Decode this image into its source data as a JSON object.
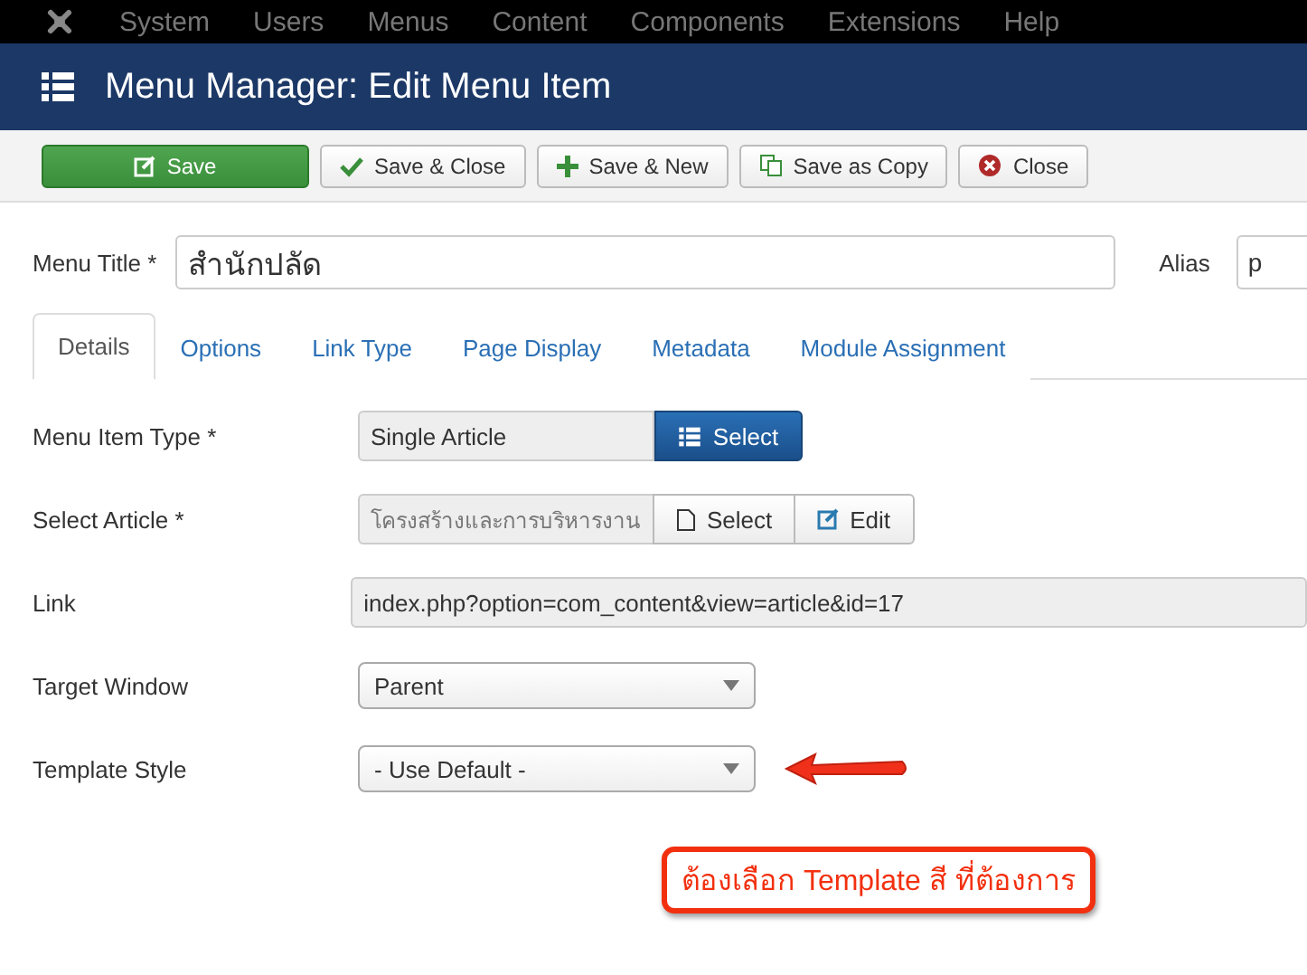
{
  "menubar": {
    "items": [
      "System",
      "Users",
      "Menus",
      "Content",
      "Components",
      "Extensions",
      "Help"
    ]
  },
  "header": {
    "title": "Menu Manager: Edit Menu Item"
  },
  "toolbar": [
    {
      "label": "Save",
      "kind": "primary"
    },
    {
      "label": "Save & Close",
      "kind": "check"
    },
    {
      "label": "Save & New",
      "kind": "plus"
    },
    {
      "label": "Save as Copy",
      "kind": "copy"
    },
    {
      "label": "Close",
      "kind": "close"
    }
  ],
  "title_row": {
    "label": "Menu Title *",
    "value": "สำนักปลัด",
    "alias_label": "Alias",
    "alias_value": "p"
  },
  "tabs": [
    {
      "label": "Details",
      "selected": true
    },
    {
      "label": "Options",
      "selected": false
    },
    {
      "label": "Link Type",
      "selected": false
    },
    {
      "label": "Page Display",
      "selected": false
    },
    {
      "label": "Metadata",
      "selected": false
    },
    {
      "label": "Module Assignment",
      "selected": false
    }
  ],
  "fields": [
    {
      "label": "Menu Item Type *",
      "kind": "type",
      "value": "Single Article",
      "buttons": [
        "Select"
      ]
    },
    {
      "label": "Select Article *",
      "kind": "article",
      "value": "โครงสร้างและการบริหารงาน",
      "buttons": [
        "Select",
        "Edit"
      ]
    },
    {
      "label": "Link",
      "kind": "readonly",
      "value": "index.php?option=com_content&view=article&id=17"
    },
    {
      "label": "Target Window",
      "kind": "dropdown",
      "value": "Parent"
    },
    {
      "label": "Template Style",
      "kind": "dropdown",
      "value": "- Use Default -",
      "arrow": true
    }
  ],
  "callout": {
    "text": "ต้องเลือก Template สี ที่ต้องการ"
  }
}
